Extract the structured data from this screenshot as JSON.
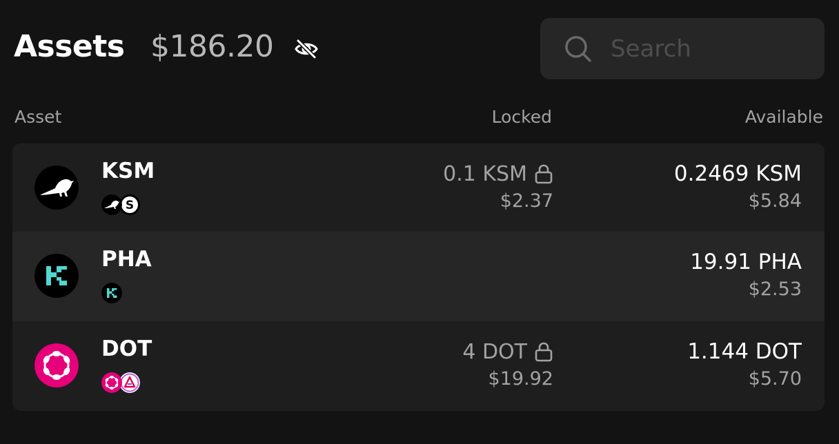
{
  "header": {
    "title": "Assets",
    "total": "$186.20"
  },
  "search": {
    "placeholder": "Search"
  },
  "columns": {
    "asset": "Asset",
    "locked": "Locked",
    "available": "Available"
  },
  "assets": [
    {
      "symbol": "KSM",
      "locked_amount": "0.1 KSM",
      "locked_usd": "$2.37",
      "available_amount": "0.2469 KSM",
      "available_usd": "$5.84",
      "icon": "kusama-bird-icon",
      "chains": [
        "kusama-icon",
        "sora-icon"
      ]
    },
    {
      "symbol": "PHA",
      "locked_amount": "",
      "locked_usd": "",
      "available_amount": "19.91 PHA",
      "available_usd": "$2.53",
      "icon": "khala-icon",
      "chains": [
        "khala-icon"
      ]
    },
    {
      "symbol": "DOT",
      "locked_amount": "4 DOT",
      "locked_usd": "$19.92",
      "available_amount": "1.144 DOT",
      "available_usd": "$5.70",
      "icon": "polkadot-icon",
      "chains": [
        "polkadot-icon",
        "acala-icon"
      ]
    }
  ],
  "colors": {
    "background": "#131313",
    "panel": "#1e1e1e",
    "panel_alt": "#262626",
    "muted_text": "#a3a3a3",
    "polkadot_pink": "#e6007a",
    "khala_cyan": "#52d6d0"
  }
}
